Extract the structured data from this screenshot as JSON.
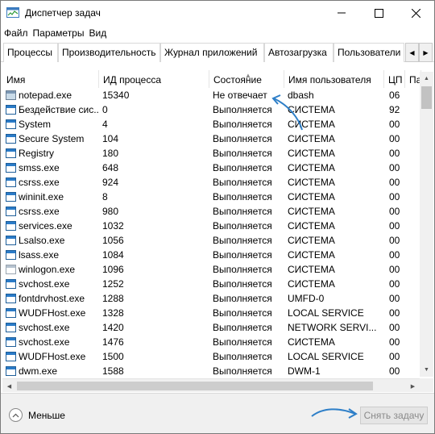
{
  "window": {
    "title": "Диспетчер задач",
    "controls": {
      "minimize": "minimize-icon",
      "maximize": "maximize-icon",
      "close": "close-icon"
    }
  },
  "menu": [
    "Файл",
    "Параметры",
    "Вид"
  ],
  "tabs": [
    "Процессы",
    "Производительность",
    "Журнал приложений",
    "Автозагрузка",
    "Пользователи"
  ],
  "table": {
    "columns": [
      "Имя",
      "ИД процесса",
      "Состояние",
      "Имя пользователя",
      "ЦП",
      "Па"
    ],
    "rows": [
      {
        "name": "notepad.exe",
        "pid": "15340",
        "status": "Не отвечает",
        "user": "dbash",
        "cpu": "06",
        "icon": "notepad"
      },
      {
        "name": "Бездействие сис...",
        "pid": "0",
        "status": "Выполняется",
        "user": "СИСТЕМА",
        "cpu": "92",
        "icon": "app"
      },
      {
        "name": "System",
        "pid": "4",
        "status": "Выполняется",
        "user": "СИСТЕМА",
        "cpu": "00",
        "icon": "app"
      },
      {
        "name": "Secure System",
        "pid": "104",
        "status": "Выполняется",
        "user": "СИСТЕМА",
        "cpu": "00",
        "icon": "app"
      },
      {
        "name": "Registry",
        "pid": "180",
        "status": "Выполняется",
        "user": "СИСТЕМА",
        "cpu": "00",
        "icon": "app"
      },
      {
        "name": "smss.exe",
        "pid": "648",
        "status": "Выполняется",
        "user": "СИСТЕМА",
        "cpu": "00",
        "icon": "app"
      },
      {
        "name": "csrss.exe",
        "pid": "924",
        "status": "Выполняется",
        "user": "СИСТЕМА",
        "cpu": "00",
        "icon": "app"
      },
      {
        "name": "wininit.exe",
        "pid": "8",
        "status": "Выполняется",
        "user": "СИСТЕМА",
        "cpu": "00",
        "icon": "app"
      },
      {
        "name": "csrss.exe",
        "pid": "980",
        "status": "Выполняется",
        "user": "СИСТЕМА",
        "cpu": "00",
        "icon": "app"
      },
      {
        "name": "services.exe",
        "pid": "1032",
        "status": "Выполняется",
        "user": "СИСТЕМА",
        "cpu": "00",
        "icon": "app"
      },
      {
        "name": "Lsalso.exe",
        "pid": "1056",
        "status": "Выполняется",
        "user": "СИСТЕМА",
        "cpu": "00",
        "icon": "app"
      },
      {
        "name": "lsass.exe",
        "pid": "1084",
        "status": "Выполняется",
        "user": "СИСТЕМА",
        "cpu": "00",
        "icon": "app"
      },
      {
        "name": "winlogon.exe",
        "pid": "1096",
        "status": "Выполняется",
        "user": "СИСТЕМА",
        "cpu": "00",
        "icon": "blank"
      },
      {
        "name": "svchost.exe",
        "pid": "1252",
        "status": "Выполняется",
        "user": "СИСТЕМА",
        "cpu": "00",
        "icon": "app"
      },
      {
        "name": "fontdrvhost.exe",
        "pid": "1288",
        "status": "Выполняется",
        "user": "UMFD-0",
        "cpu": "00",
        "icon": "app"
      },
      {
        "name": "WUDFHost.exe",
        "pid": "1328",
        "status": "Выполняется",
        "user": "LOCAL SERVICE",
        "cpu": "00",
        "icon": "app"
      },
      {
        "name": "svchost.exe",
        "pid": "1420",
        "status": "Выполняется",
        "user": "NETWORK SERVI...",
        "cpu": "00",
        "icon": "app"
      },
      {
        "name": "svchost.exe",
        "pid": "1476",
        "status": "Выполняется",
        "user": "СИСТЕМА",
        "cpu": "00",
        "icon": "app"
      },
      {
        "name": "WUDFHost.exe",
        "pid": "1500",
        "status": "Выполняется",
        "user": "LOCAL SERVICE",
        "cpu": "00",
        "icon": "app"
      },
      {
        "name": "dwm.exe",
        "pid": "1588",
        "status": "Выполняется",
        "user": "DWM-1",
        "cpu": "00",
        "icon": "app"
      }
    ]
  },
  "footer": {
    "fewer_label": "Меньше",
    "end_task_label": "Снять задачу"
  },
  "colors": {
    "annotation_arrow": "#2e7fc8",
    "disabled_text": "#8a8a8a"
  }
}
